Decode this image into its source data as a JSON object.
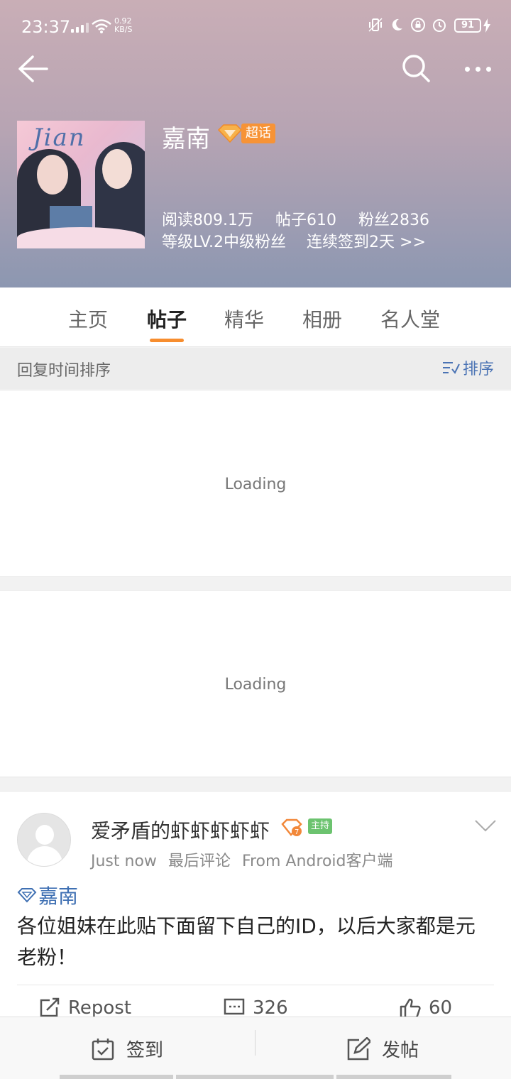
{
  "status_bar": {
    "time": "23:37",
    "net_speed_value": "0.92",
    "net_speed_unit": "KB/S",
    "battery": "91"
  },
  "header": {
    "topic_name": "嘉南",
    "badge": "超话",
    "stats": {
      "reads": "阅读809.1万",
      "posts": "帖子610",
      "fans": "粉丝2836"
    },
    "level": "等级LV.2中级粉丝",
    "checkin": "连续签到2天 >>"
  },
  "tabs": [
    {
      "label": "主页"
    },
    {
      "label": "帖子",
      "active": true
    },
    {
      "label": "精华"
    },
    {
      "label": "相册"
    },
    {
      "label": "名人堂"
    }
  ],
  "sort_bar": {
    "label": "回复时间排序",
    "button": "排序"
  },
  "loading": [
    "Loading",
    "Loading"
  ],
  "post": {
    "username": "爱矛盾的虾虾虾虾虾",
    "mod_badge": "主持",
    "time": "Just now",
    "last_comment": "最后评论",
    "source": "From Android客户端",
    "topic": "嘉南",
    "text": "各位姐妹在此贴下面留下自己的ID，以后大家都是元老粉！",
    "repost_label": "Repost",
    "comments": "326",
    "likes": "60"
  },
  "bottom_bar": {
    "checkin": "签到",
    "post": "发帖"
  },
  "colors": {
    "accent": "#f78d2e",
    "link": "#3f70b3",
    "header_top": "#c9aeb6",
    "header_bottom": "#8c97b1",
    "mod_badge": "#6cc36f"
  }
}
